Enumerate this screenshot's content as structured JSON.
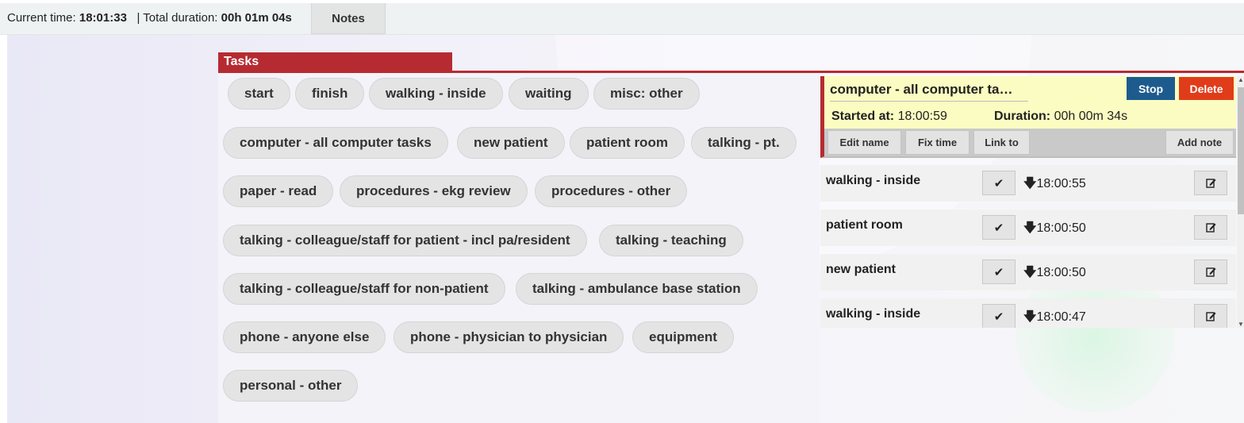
{
  "topbar": {
    "current_time_label": "Current time:",
    "current_time": "18:01:33",
    "separator": "|",
    "total_duration_label": "Total duration:",
    "total_duration": "00h 01m 04s",
    "notes_label": "Notes"
  },
  "tasks": {
    "header": "Tasks",
    "buttons": [
      "start",
      "finish",
      "walking - inside",
      "waiting",
      "misc: other",
      "computer - all computer tasks",
      "new patient",
      "patient room",
      "talking - pt.",
      "paper - read",
      "procedures - ekg review",
      "procedures - other",
      "talking - colleague/staff for patient - incl pa/resident",
      "talking - teaching",
      "talking - colleague/staff for non-patient",
      "talking - ambulance base station",
      "phone - anyone else",
      "phone - physician to physician",
      "equipment",
      "personal - other"
    ]
  },
  "active_task": {
    "name": "computer - all computer ta…",
    "stop_label": "Stop",
    "delete_label": "Delete",
    "started_label": "Started at:",
    "started_value": "18:00:59",
    "duration_label": "Duration:",
    "duration_value": "00h 00m 34s",
    "edit_name_label": "Edit name",
    "fix_time_label": "Fix time",
    "link_to_label": "Link to",
    "add_note_label": "Add note"
  },
  "history": [
    {
      "name": "walking - inside",
      "time": "18:00:55"
    },
    {
      "name": "patient room",
      "time": "18:00:50"
    },
    {
      "name": "new patient",
      "time": "18:00:50"
    },
    {
      "name": "walking - inside",
      "time": "18:00:47"
    }
  ],
  "icons": {
    "check": "check-icon",
    "arrow_down": "arrow-down-icon",
    "edit": "edit-icon"
  },
  "colors": {
    "tasks_accent": "#b62b31",
    "stop": "#1d5b8e",
    "delete": "#e03c1a",
    "active_card_bg": "#fbfcc1"
  }
}
